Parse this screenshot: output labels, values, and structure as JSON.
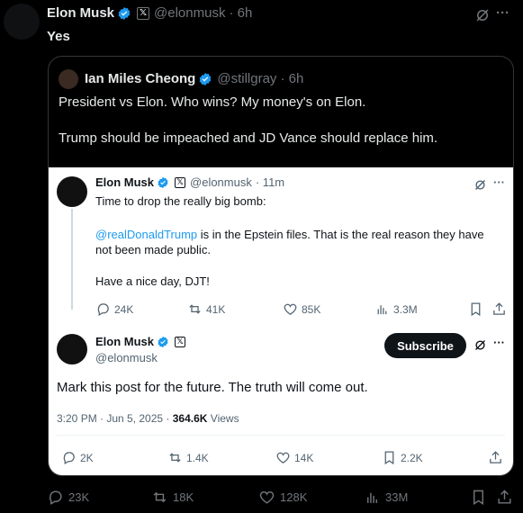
{
  "outer": {
    "author_name": "Elon Musk",
    "handle": "@elonmusk",
    "time": "· 6h",
    "text": "Yes",
    "more": "···"
  },
  "quoted": {
    "author_name": "Ian Miles Cheong",
    "handle": "@stillgray",
    "time": "· 6h",
    "line1": "President vs Elon. Who wins? My money's on Elon.",
    "line2": "Trump should be impeached and JD Vance should replace him."
  },
  "embedded_reply": {
    "author_name": "Elon Musk",
    "handle": "@elonmusk",
    "time": "· 11m",
    "line1": "Time to drop the really big bomb:",
    "mention": "@realDonaldTrump",
    "line2_rest": " is in the Epstein files. That is the real reason they have",
    "line3": "not been made public.",
    "line4": "Have a nice day, DJT!",
    "metrics": {
      "replies": "24K",
      "reposts": "41K",
      "likes": "85K",
      "views": "3.3M"
    }
  },
  "embedded_main": {
    "author_name": "Elon Musk",
    "handle": "@elonmusk",
    "subscribe_label": "Subscribe",
    "text": "Mark this post for the future. The truth will come out.",
    "time": "3:20 PM · Jun 5, 2025 · ",
    "views_count": "364.6K",
    "views_label": " Views",
    "metrics": {
      "replies": "2K",
      "reposts": "1.4K",
      "likes": "14K",
      "bookmarks": "2.2K"
    }
  },
  "outer_metrics": {
    "replies": "23K",
    "reposts": "18K",
    "likes": "128K",
    "views": "33M"
  },
  "colors": {
    "verified": "#1d9bf0",
    "link": "#1d9bf0",
    "background": "#000000",
    "card_border": "#333639"
  },
  "icons": [
    "verified-badge-icon",
    "x-logo-icon",
    "grok-icon",
    "more-icon",
    "reply-icon",
    "repost-icon",
    "like-icon",
    "views-icon",
    "bookmark-icon",
    "share-icon"
  ]
}
